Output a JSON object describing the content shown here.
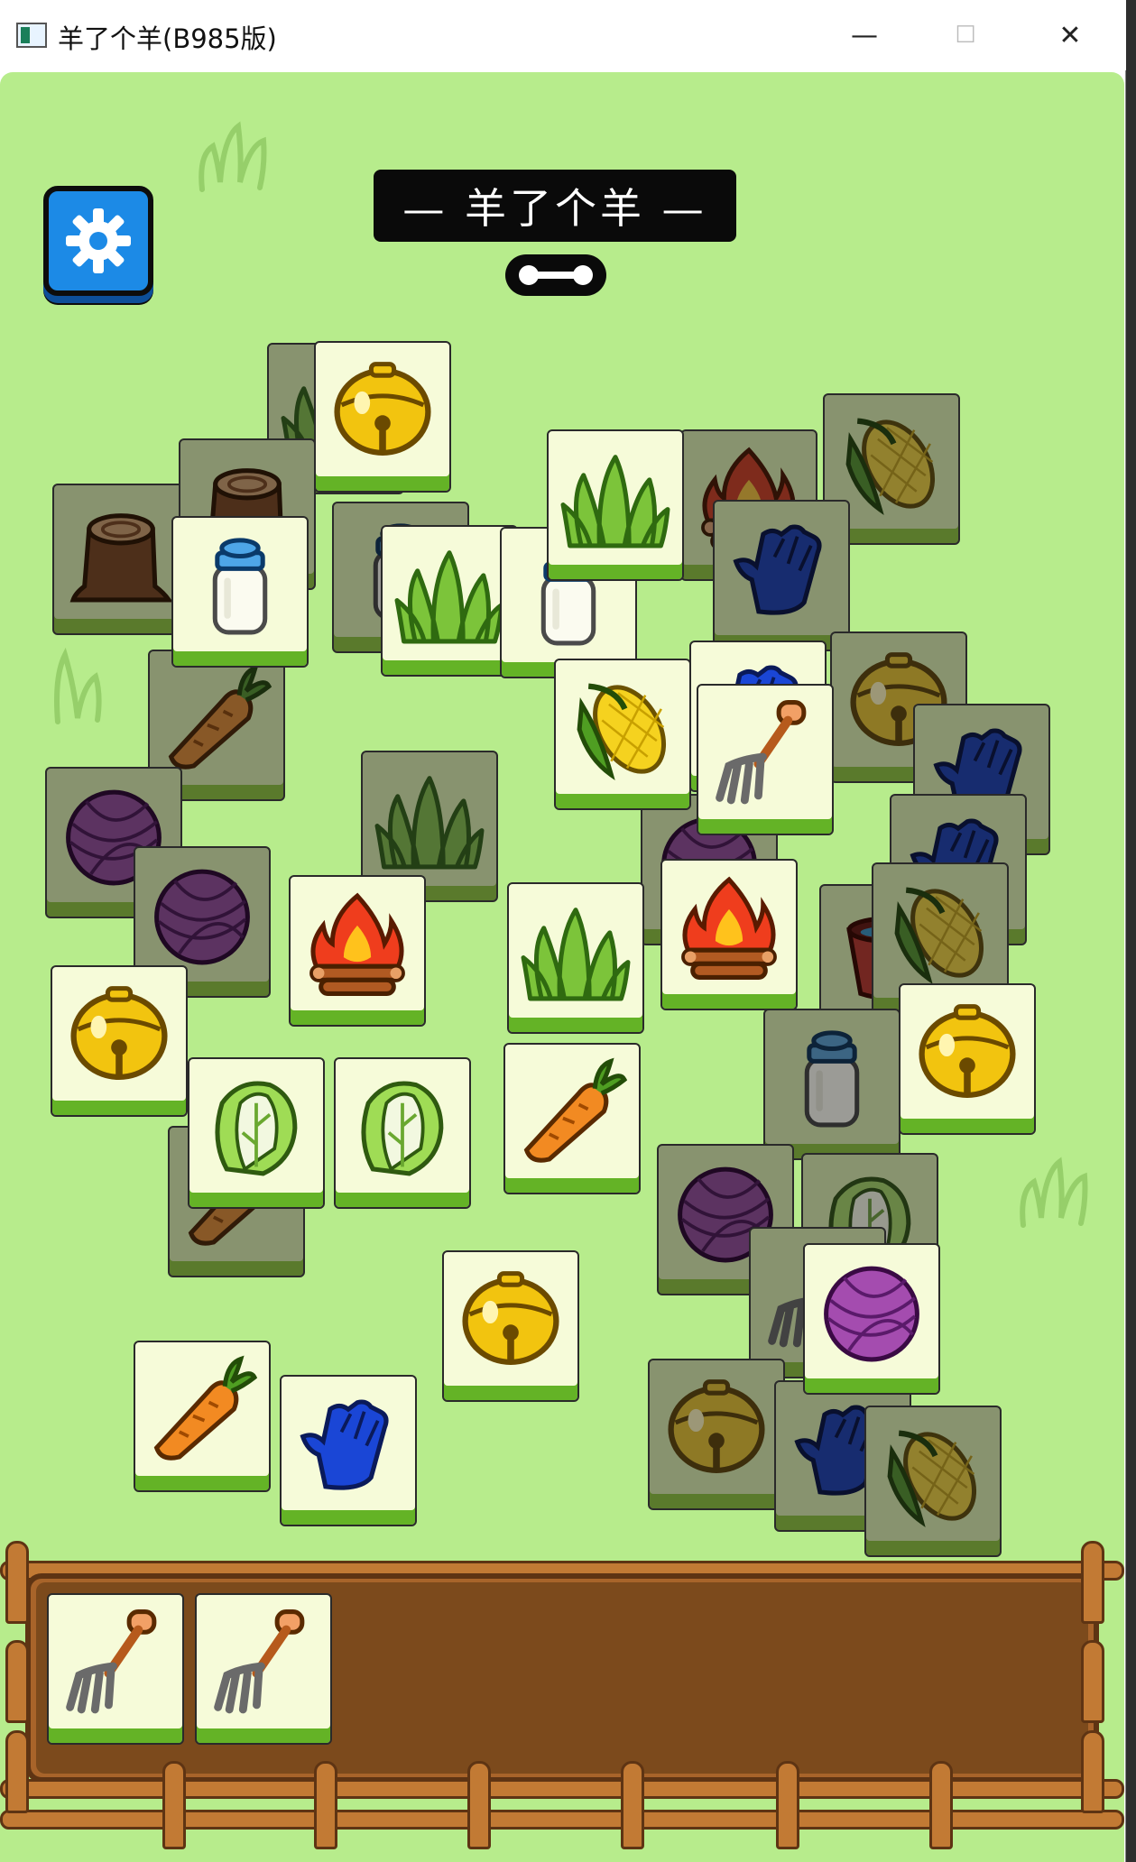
{
  "window": {
    "title": "羊了个羊(B985版)",
    "minimize_glyph": "—",
    "maximize_glyph": "☐",
    "close_glyph": "✕"
  },
  "game": {
    "banner": "— 羊了个羊 —",
    "background_color": "#b7ec8c"
  },
  "tile_types": [
    "bell",
    "grass",
    "fire",
    "corn",
    "glove",
    "milk",
    "stump",
    "carrot",
    "yarn",
    "cabbage",
    "pitchfork",
    "bucket"
  ],
  "board_tiles": [
    {
      "type": "grass",
      "state": "covered"
    },
    {
      "type": "bell",
      "state": "open"
    },
    {
      "type": "stump",
      "state": "covered"
    },
    {
      "type": "stump",
      "state": "covered"
    },
    {
      "type": "milk",
      "state": "open"
    },
    {
      "type": "milk",
      "state": "covered"
    },
    {
      "type": "grass",
      "state": "open"
    },
    {
      "type": "milk",
      "state": "open"
    },
    {
      "type": "grass",
      "state": "open"
    },
    {
      "type": "fire",
      "state": "covered"
    },
    {
      "type": "corn",
      "state": "covered"
    },
    {
      "type": "glove",
      "state": "covered"
    },
    {
      "type": "carrot",
      "state": "covered"
    },
    {
      "type": "yarn",
      "state": "covered"
    },
    {
      "type": "grass",
      "state": "covered"
    },
    {
      "type": "corn",
      "state": "open"
    },
    {
      "type": "glove",
      "state": "open"
    },
    {
      "type": "pitchfork",
      "state": "open"
    },
    {
      "type": "bell",
      "state": "covered"
    },
    {
      "type": "glove",
      "state": "covered"
    },
    {
      "type": "glove",
      "state": "covered"
    },
    {
      "type": "yarn",
      "state": "covered"
    },
    {
      "type": "yarn",
      "state": "covered"
    },
    {
      "type": "fire",
      "state": "open"
    },
    {
      "type": "grass",
      "state": "open"
    },
    {
      "type": "fire",
      "state": "open"
    },
    {
      "type": "bucket",
      "state": "covered"
    },
    {
      "type": "corn",
      "state": "covered"
    },
    {
      "type": "bell",
      "state": "open"
    },
    {
      "type": "cabbage",
      "state": "open"
    },
    {
      "type": "cabbage",
      "state": "open"
    },
    {
      "type": "carrot",
      "state": "open"
    },
    {
      "type": "milk",
      "state": "covered"
    },
    {
      "type": "bell",
      "state": "open"
    },
    {
      "type": "carrot",
      "state": "covered"
    },
    {
      "type": "yarn",
      "state": "covered"
    },
    {
      "type": "cabbage",
      "state": "covered"
    },
    {
      "type": "pitchfork",
      "state": "covered"
    },
    {
      "type": "bell",
      "state": "open"
    },
    {
      "type": "yarn",
      "state": "open"
    },
    {
      "type": "carrot",
      "state": "open"
    },
    {
      "type": "glove",
      "state": "open"
    },
    {
      "type": "bell",
      "state": "covered"
    },
    {
      "type": "glove",
      "state": "covered"
    },
    {
      "type": "corn",
      "state": "covered"
    }
  ],
  "tray": {
    "capacity": 7,
    "slots": [
      "pitchfork",
      "pitchfork"
    ]
  }
}
